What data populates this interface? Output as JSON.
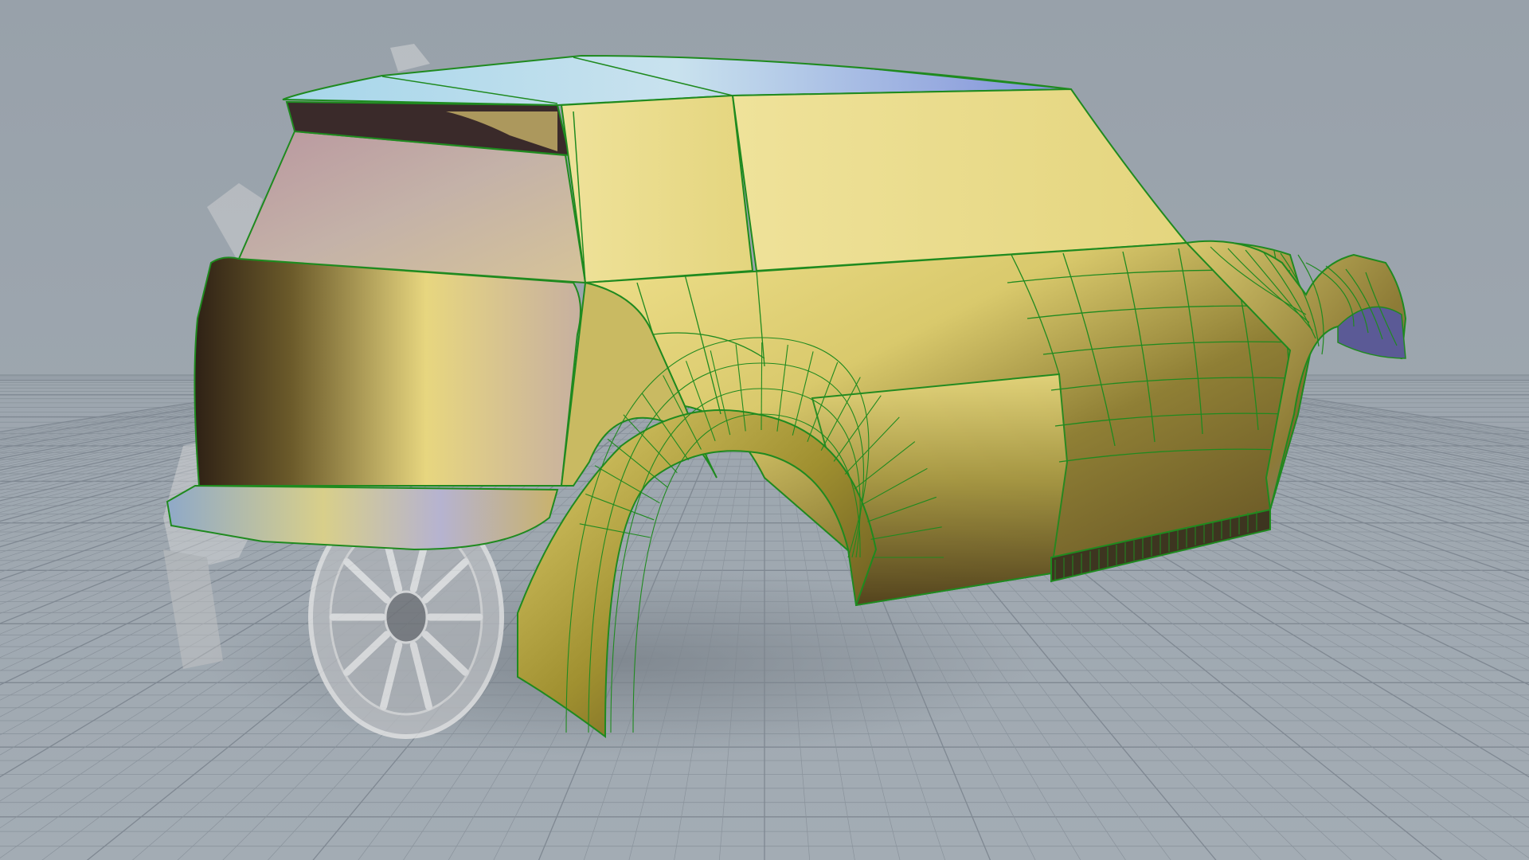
{
  "viewport": {
    "background_color": "#9aa3ac",
    "grid_line_color": "#8a939c",
    "grid_major_color": "#7f8892",
    "model_surface_colors": [
      "#e9dd88",
      "#8f8a40",
      "#3a2c1a",
      "#a8d8ee",
      "#b48a9a"
    ],
    "edge_color": "#1f8a1f"
  }
}
